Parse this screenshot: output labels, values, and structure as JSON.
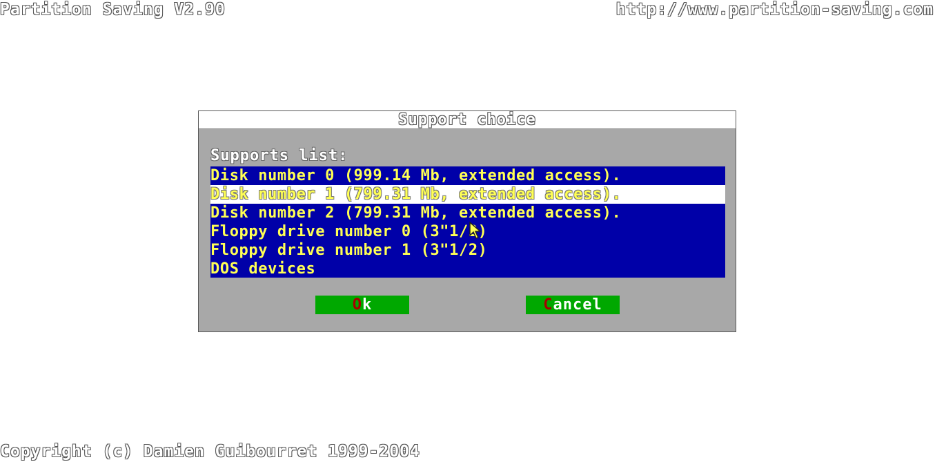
{
  "header": {
    "app_title": "Partition Saving V2.90",
    "url": "http://www.partition-saving.com"
  },
  "dialog": {
    "title": "Support choice",
    "list_label": "Supports list:",
    "items": [
      {
        "label": "Disk number 0 (999.14 Mb, extended access)."
      },
      {
        "label": "Disk number 1 (799.31 Mb, extended access).",
        "selected": true
      },
      {
        "label": "Disk number 2 (799.31 Mb, extended access)."
      },
      {
        "label": "Floppy drive number 0 (3\"1/2)"
      },
      {
        "label": "Floppy drive number 1 (3\"1/2)"
      },
      {
        "label": "DOS devices"
      }
    ],
    "ok_button": {
      "hotkey": "O",
      "rest": "k"
    },
    "cancel_button": {
      "hotkey": "C",
      "rest": "ancel"
    }
  },
  "footer": {
    "copyright": "Copyright (c) Damien Guibourret 1999-2004"
  },
  "colors": {
    "list_background": "#0000a8",
    "list_text": "#ffff54",
    "dialog_background": "#a8a8a8",
    "button_background": "#00a800",
    "button_hotkey": "#a80000"
  },
  "icons": {
    "pointer": "mouse-pointer-icon"
  }
}
